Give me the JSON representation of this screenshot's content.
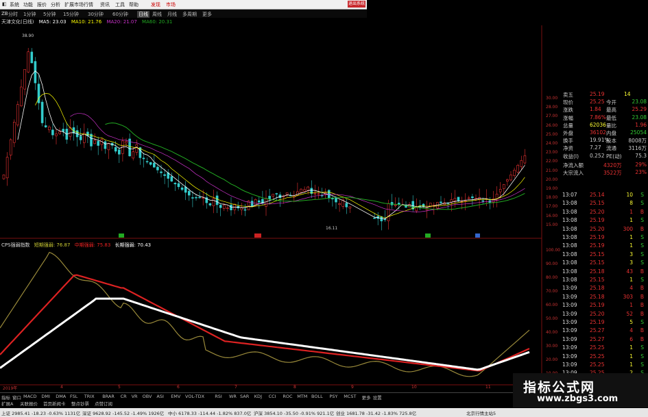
{
  "menu": {
    "items": [
      "系统",
      "功能",
      "报价",
      "分析",
      "扩展市场行情",
      "资讯",
      "工具",
      "帮助"
    ],
    "highlight": [
      "发现",
      "市场"
    ],
    "close": "退出系统"
  },
  "periods": {
    "items": [
      "分时",
      "1分钟",
      "5分钟",
      "15分钟",
      "30分钟",
      "60分钟",
      "日线",
      "周线",
      "月线",
      "多周期",
      "更多"
    ],
    "selected": "日线",
    "left_label": "ZB"
  },
  "ma_legend": {
    "stock": "天津文化(日线)",
    "ma5": "MA5: 23.03",
    "ma10": "MA10: 21.76",
    "ma20": "MA20: 21.07",
    "ma60": "MA60: 20.31",
    "peak": "38.90"
  },
  "ind_legend": {
    "name": "CPS强弱指数",
    "short": "短期强弱: 76.87",
    "mid": "中期强弱: 75.83",
    "long": "长期强弱: 70.43"
  },
  "price_axis": [
    "30.00",
    "28.00",
    "27.00",
    "26.00",
    "25.00",
    "24.00",
    "23.00",
    "22.00",
    "21.00",
    "20.00",
    "19.00",
    "18.00",
    "17.00",
    "16.00",
    "15.00"
  ],
  "ind_axis": [
    "100.00",
    "90.00",
    "80.00",
    "70.00",
    "60.00",
    "50.00",
    "40.00",
    "30.00",
    "20.00",
    "10.00"
  ],
  "quote": {
    "rows": [
      {
        "l": "卖五",
        "v": "25.19",
        "n": "14",
        "c": "#e33"
      },
      {
        "l": "现价",
        "v": "25.25",
        "l2": "今开",
        "v2": "23.08",
        "c": "#e33",
        "c2": "#3c3"
      },
      {
        "l": "涨跌",
        "v": "1.84",
        "l2": "最高",
        "v2": "25.29",
        "c": "#e33",
        "c2": "#e33"
      },
      {
        "l": "涨幅",
        "v": "7.86%",
        "l2": "最低",
        "v2": "23.08",
        "c": "#e33",
        "c2": "#3c3"
      },
      {
        "l": "总量",
        "v": "62036",
        "l2": "量比",
        "v2": "1.96",
        "c": "#ff3",
        "c2": "#e33"
      },
      {
        "l": "外盘",
        "v": "36102",
        "l2": "内盘",
        "v2": "25054",
        "c": "#e33",
        "c2": "#3c3"
      },
      {
        "l": "换手",
        "v": "19.91%",
        "l2": "股本",
        "v2": "8008万",
        "c": "#ccc",
        "c2": "#ccc"
      },
      {
        "l": "净资",
        "v": "7.27",
        "l2": "流通",
        "v2": "3116万",
        "c": "#ccc",
        "c2": "#ccc"
      },
      {
        "l": "收益(I)",
        "v": "0.252",
        "l2": "PE(动)",
        "v2": "75.3",
        "c": "#ccc",
        "c2": "#ccc"
      }
    ],
    "flow": [
      {
        "l": "净流入额",
        "v": "4320万",
        "p": "29%"
      },
      {
        "l": "大宗流入",
        "v": "3522万",
        "p": "23%"
      }
    ]
  },
  "ticks": [
    {
      "t": "13:07",
      "p": "25.14",
      "v": "10",
      "s": "S"
    },
    {
      "t": "13:08",
      "p": "25.15",
      "v": "8",
      "s": "S"
    },
    {
      "t": "13:08",
      "p": "25.20",
      "v": "1",
      "s": "B"
    },
    {
      "t": "13:08",
      "p": "25.19",
      "v": "1",
      "s": "S"
    },
    {
      "t": "13:08",
      "p": "25.20",
      "v": "300",
      "s": "B"
    },
    {
      "t": "13:08",
      "p": "25.19",
      "v": "1",
      "s": "S"
    },
    {
      "t": "13:08",
      "p": "25.19",
      "v": "1",
      "s": "S"
    },
    {
      "t": "13:08",
      "p": "25.15",
      "v": "3",
      "s": "S"
    },
    {
      "t": "13:08",
      "p": "25.15",
      "v": "3",
      "s": "S"
    },
    {
      "t": "13:08",
      "p": "25.18",
      "v": "43",
      "s": "B"
    },
    {
      "t": "13:08",
      "p": "25.15",
      "v": "1",
      "s": "S"
    },
    {
      "t": "13:09",
      "p": "25.18",
      "v": "4",
      "s": "B"
    },
    {
      "t": "13:09",
      "p": "25.18",
      "v": "303",
      "s": "B"
    },
    {
      "t": "13:09",
      "p": "25.19",
      "v": "1",
      "s": "B"
    },
    {
      "t": "13:09",
      "p": "25.20",
      "v": "52",
      "s": "B"
    },
    {
      "t": "13:09",
      "p": "25.19",
      "v": "5",
      "s": "S"
    },
    {
      "t": "13:09",
      "p": "25.27",
      "v": "4",
      "s": "B"
    },
    {
      "t": "13:09",
      "p": "25.27",
      "v": "6",
      "s": "B"
    },
    {
      "t": "13:09",
      "p": "25.25",
      "v": "1",
      "s": "S"
    },
    {
      "t": "13:09",
      "p": "25.25",
      "v": "1",
      "s": "S"
    },
    {
      "t": "13:09",
      "p": "25.25",
      "v": "1",
      "s": "S"
    },
    {
      "t": "13:09",
      "p": "25.25",
      "v": "2",
      "s": "S"
    }
  ],
  "date_axis": [
    "2019年",
    "4",
    "5",
    "6",
    "7",
    "8",
    "9",
    "10",
    "11"
  ],
  "event_markers": [
    "融",
    "D转",
    "融",
    "融"
  ],
  "low_label": "16.11",
  "tabs": [
    "指标",
    "窗口",
    "MACD",
    "DMI",
    "DMA",
    "FSL",
    "TRIX",
    "BRAR",
    "CR",
    "VR",
    "OBV",
    "ASI",
    "EMV",
    "VOL-TDX",
    "RSI",
    "WR",
    "SAR",
    "KDJ",
    "CCI",
    "ROC",
    "MTM",
    "BOLL",
    "PSY",
    "MCST",
    "更多",
    "设置"
  ],
  "subtabs": [
    "扩展A",
    "关联报价",
    "首页新闻卡",
    "整点钞票",
    "点赞订阅"
  ],
  "status": [
    "上证 2985.41 -18.23 -0.63% 1131亿",
    "深证 9628.92 -145.52 -1.49% 1926亿",
    "中小 6178.33 -114.44 -1.82% 837.0亿",
    "沪深 3854.10 -35.50 -0.91% 921.1亿",
    "创业 1681.78 -31.42 -1.83% 725.8亿",
    "北京行情主站5"
  ],
  "watermark": {
    "line1": "指标公式网",
    "line2": "www.zbgs3.com"
  },
  "colors": {
    "up": "#e33",
    "down": "#3cc",
    "ma5": "#fff",
    "ma10": "#ff0",
    "ma20": "#c3c",
    "ma60": "#2a2",
    "short": "#9a8a3a",
    "mid": "#d22",
    "long": "#fff"
  }
}
